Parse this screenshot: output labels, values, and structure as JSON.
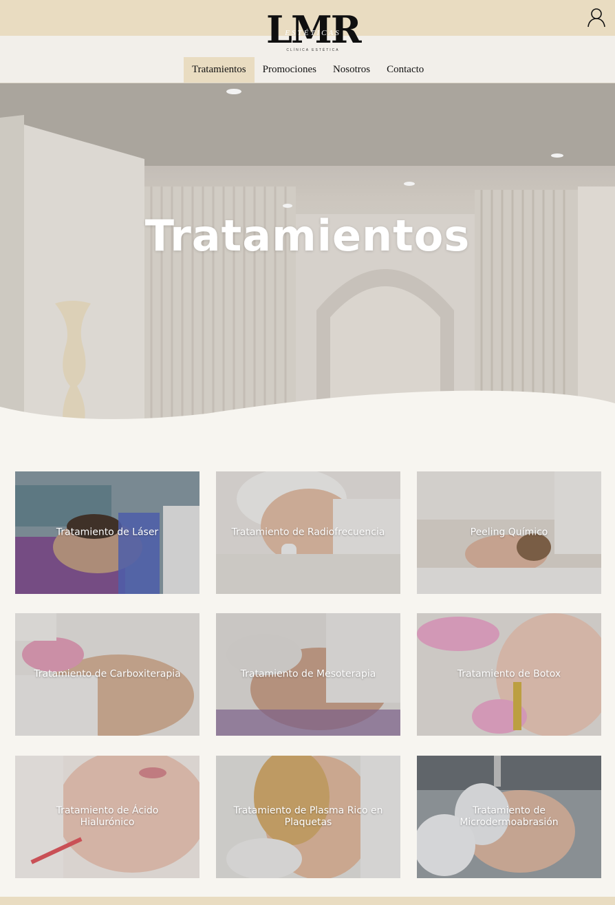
{
  "header": {
    "logo_mark": "LMR",
    "logo_sub": "Estéticas",
    "logo_tag": "Clínica estética",
    "user_icon": "user-icon"
  },
  "nav": {
    "items": [
      {
        "label": "Tratamientos",
        "active": true
      },
      {
        "label": "Promociones"
      },
      {
        "label": "Nosotros"
      },
      {
        "label": "Contacto"
      }
    ]
  },
  "hero": {
    "title": "Tratamientos"
  },
  "treatments": [
    {
      "label": "Tratamiento de Láser",
      "tone": "#7f8f9b"
    },
    {
      "label": "Tratamiento de Radiofrecuencia",
      "tone": "#cfc6bd"
    },
    {
      "label": "Peeling Químico",
      "tone": "#d9d2c8"
    },
    {
      "label": "Tratamiento de Carboxiterapia",
      "tone": "#d7cbc0"
    },
    {
      "label": "Tratamiento de Mesoterapia",
      "tone": "#c9b8ae"
    },
    {
      "label": "Tratamiento de Botox",
      "tone": "#e3cfc6"
    },
    {
      "label": "Tratamiento de Ácido Hialurónico",
      "tone": "#e8d4cc"
    },
    {
      "label": "Tratamiento de Plasma Rico en Plaquetas",
      "tone": "#d4b99a"
    },
    {
      "label": "Tratamiento de Microdermoabrasión",
      "tone": "#b9b5b3"
    }
  ],
  "colors": {
    "beige": "#e9dcc1",
    "cream": "#f7f5f0"
  }
}
